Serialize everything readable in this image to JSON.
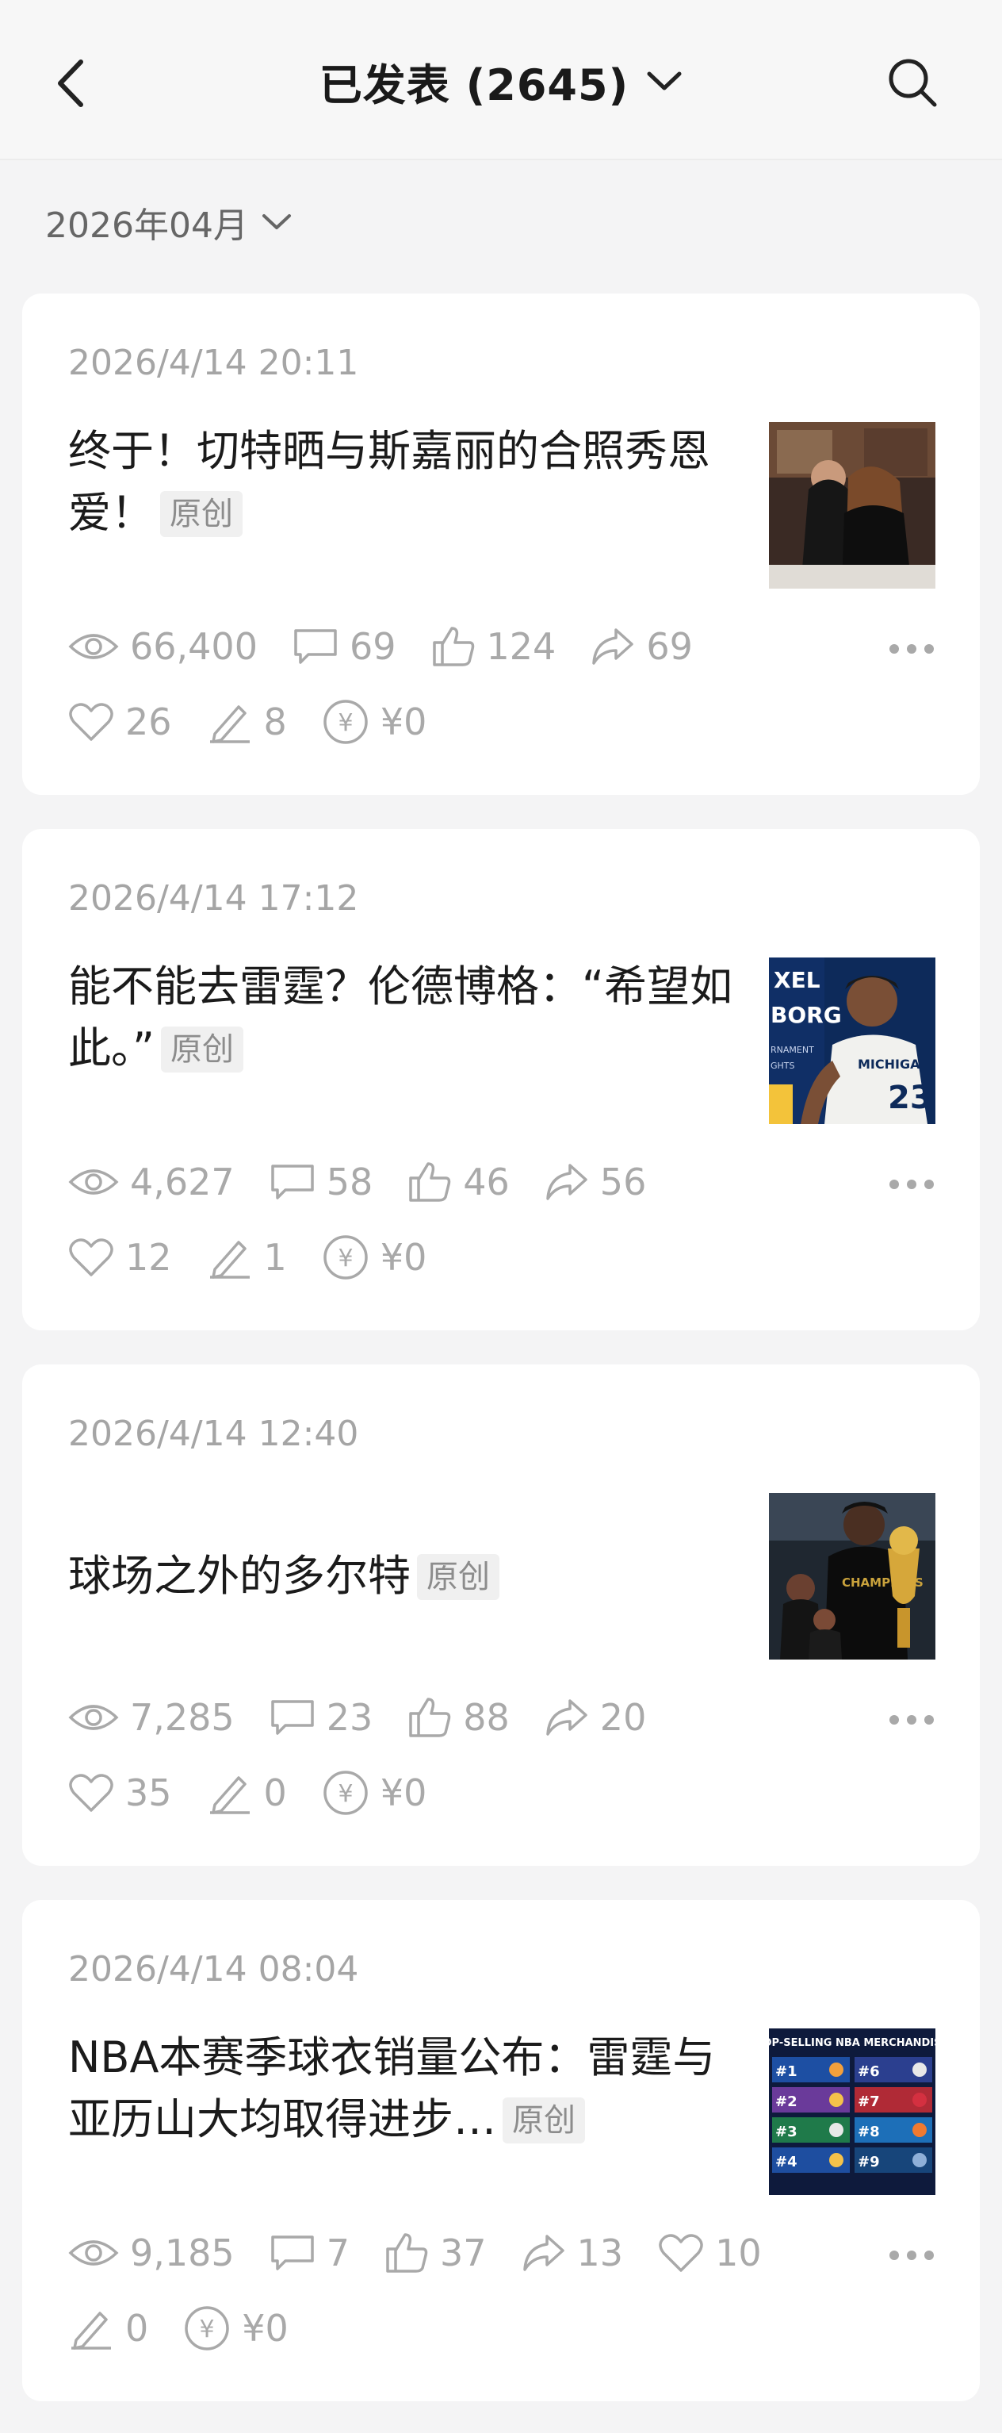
{
  "header": {
    "title": "已发表 (2645)",
    "back_icon": "back-arrow-icon",
    "search_icon": "search-icon",
    "caret_icon": "chevron-down-icon"
  },
  "filter": {
    "month": "2026年04月"
  },
  "colors": {
    "background": "#f4f4f5",
    "card": "#ffffff",
    "muted_text": "#a9a9a9",
    "tag_bg": "#f0f0f0"
  },
  "posts": [
    {
      "date": "2026/4/14 20:11",
      "title": "终于！切特晒与斯嘉丽的合照秀恩爱！",
      "tag": "原创",
      "views": "66,400",
      "comments": "69",
      "likes": "124",
      "shares": "69",
      "favorites": "26",
      "edits": "8",
      "earnings": "¥0"
    },
    {
      "date": "2026/4/14 17:12",
      "title": "能不能去雷霆？伦德博格：“希望如此。”",
      "tag": "原创",
      "thumb_text": [
        "XEL",
        "BORG",
        "RNAMENT",
        "GHTS",
        "MICHIGA",
        "23"
      ],
      "views": "4,627",
      "comments": "58",
      "likes": "46",
      "shares": "56",
      "favorites": "12",
      "edits": "1",
      "earnings": "¥0"
    },
    {
      "date": "2026/4/14 12:40",
      "title": "球场之外的多尔特",
      "tag": "原创",
      "thumb_text": [
        "CHAMPIONS"
      ],
      "views": "7,285",
      "comments": "23",
      "likes": "88",
      "shares": "20",
      "favorites": "35",
      "edits": "0",
      "earnings": "¥0"
    },
    {
      "date": "2026/4/14 08:04",
      "title": "NBA本赛季球衣销量公布：雷霆与亚历山大均取得进步…",
      "tag": "原创",
      "thumb_text": [
        "TOP-SELLING NBA MERCHANDISE",
        "#1",
        "#6",
        "#2",
        "#7",
        "#3",
        "#8",
        "#4",
        "#9"
      ],
      "views": "9,185",
      "comments": "7",
      "likes": "37",
      "shares": "13",
      "favorites": "10",
      "edits": "0",
      "earnings": "¥0"
    }
  ]
}
